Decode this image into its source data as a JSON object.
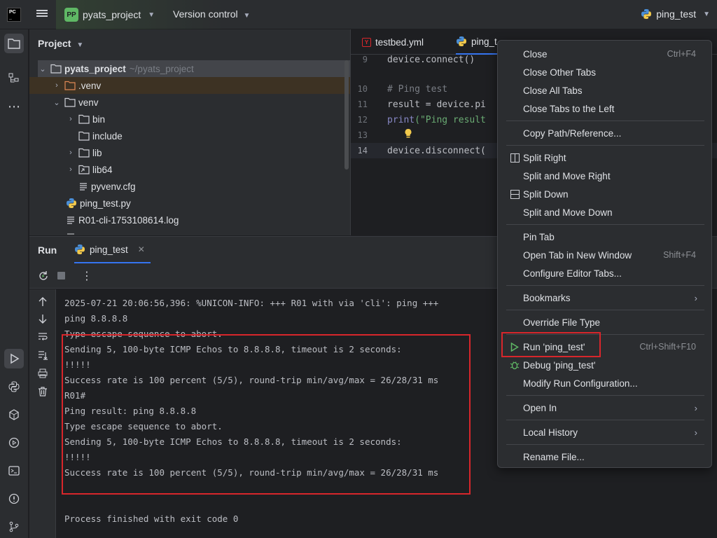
{
  "titlebar": {
    "project_badge": "PP",
    "project_name": "pyats_project",
    "version_control": "Version control",
    "run_config": "ping_test"
  },
  "project_panel": {
    "title": "Project",
    "items": [
      {
        "label": "pyats_project",
        "path": "~/pyats_project"
      },
      {
        "label": ".venv"
      },
      {
        "label": "venv"
      },
      {
        "label": "bin"
      },
      {
        "label": "include"
      },
      {
        "label": "lib"
      },
      {
        "label": "lib64"
      },
      {
        "label": "pyvenv.cfg"
      },
      {
        "label": "ping_test.py"
      },
      {
        "label": "R01-cli-1753108614.log"
      }
    ]
  },
  "editor": {
    "tabs": [
      {
        "label": "testbed.yml"
      },
      {
        "label": "ping_t"
      }
    ],
    "lines": [
      {
        "num": "9",
        "code": "device.connect()"
      },
      {
        "num": "10",
        "code": "# Ping test"
      },
      {
        "num": "11",
        "code": "result = device.pi"
      },
      {
        "num": "12",
        "code_builtin": "print",
        "code_rest": "(\"Ping result"
      },
      {
        "num": "13",
        "code": ""
      },
      {
        "num": "14",
        "code": "device.disconnect("
      }
    ]
  },
  "run_panel": {
    "label": "Run",
    "tab_label": "ping_test",
    "console": [
      "2025-07-21 20:06:56,396: %UNICON-INFO: +++ R01 with via 'cli': ping +++",
      "ping 8.8.8.8",
      "Type escape sequence to abort.",
      "Sending 5, 100-byte ICMP Echos to 8.8.8.8, timeout is 2 seconds:",
      "!!!!!",
      "Success rate is 100 percent (5/5), round-trip min/avg/max = 26/28/31 ms",
      "R01#",
      "Ping result: ping 8.8.8.8",
      "Type escape sequence to abort.",
      "Sending 5, 100-byte ICMP Echos to 8.8.8.8, timeout is 2 seconds:",
      "!!!!!",
      "Success rate is 100 percent (5/5), round-trip min/avg/max = 26/28/31 ms",
      "",
      "",
      "Process finished with exit code 0"
    ]
  },
  "context_menu": {
    "close": {
      "label": "Close",
      "shortcut": "Ctrl+F4"
    },
    "close_other": {
      "label": "Close Other Tabs"
    },
    "close_all": {
      "label": "Close All Tabs"
    },
    "close_left": {
      "label": "Close Tabs to the Left"
    },
    "copy_path": {
      "label": "Copy Path/Reference..."
    },
    "split_right": {
      "label": "Split Right"
    },
    "split_move_right": {
      "label": "Split and Move Right"
    },
    "split_down": {
      "label": "Split Down"
    },
    "split_move_down": {
      "label": "Split and Move Down"
    },
    "pin_tab": {
      "label": "Pin Tab"
    },
    "open_new_window": {
      "label": "Open Tab in New Window",
      "shortcut": "Shift+F4"
    },
    "configure_tabs": {
      "label": "Configure Editor Tabs..."
    },
    "bookmarks": {
      "label": "Bookmarks"
    },
    "override_type": {
      "label": "Override File Type"
    },
    "run": {
      "label": "Run 'ping_test'",
      "shortcut": "Ctrl+Shift+F10"
    },
    "debug": {
      "label": "Debug 'ping_test'"
    },
    "modify_run": {
      "label": "Modify Run Configuration..."
    },
    "open_in": {
      "label": "Open In"
    },
    "local_history": {
      "label": "Local History"
    },
    "rename": {
      "label": "Rename File..."
    }
  },
  "colors": {
    "accent": "#3574f0",
    "highlight_red": "#d8262b",
    "run_green": "#5fb865"
  }
}
